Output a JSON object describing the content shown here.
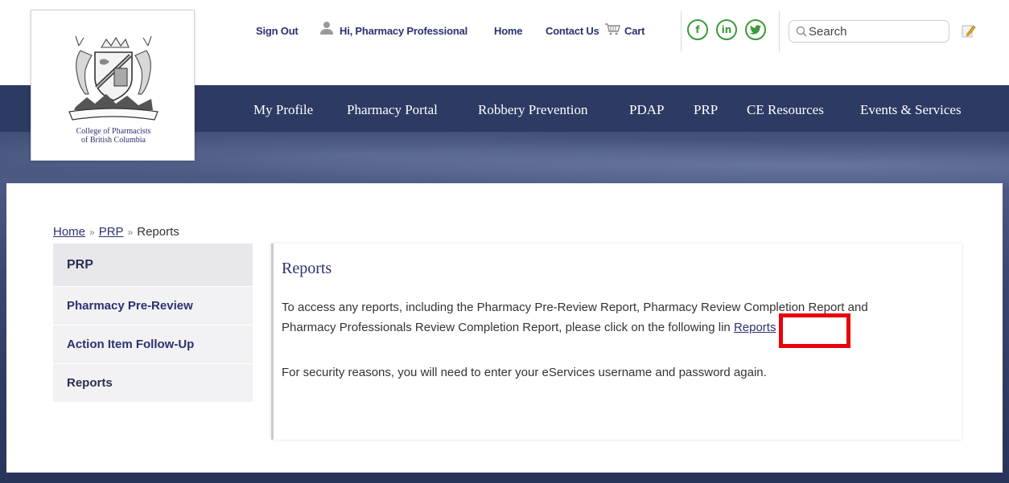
{
  "header": {
    "sign_out": "Sign Out",
    "greeting": "Hi, Pharmacy Professional",
    "home": "Home",
    "contact_us": "Contact Us",
    "cart": "Cart",
    "social": {
      "facebook": "f",
      "linkedin": "in",
      "twitter": "t"
    },
    "search_placeholder": "Search",
    "icons": [
      "user-icon",
      "cart-icon",
      "facebook-icon",
      "linkedin-icon",
      "twitter-icon",
      "search-icon",
      "edit-icon"
    ]
  },
  "logo": {
    "line1": "College of Pharmacists",
    "line2": "of British Columbia"
  },
  "nav": {
    "items": [
      "My Profile",
      "Pharmacy Portal",
      "Robbery Prevention",
      "PDAP",
      "PRP",
      "CE Resources",
      "Events & Services"
    ]
  },
  "breadcrumb": {
    "home": "Home",
    "sep": "»",
    "prp": "PRP",
    "current": "Reports"
  },
  "sidebar": {
    "heading": "PRP",
    "items": [
      "Pharmacy Pre-Review",
      "Action Item Follow-Up",
      "Reports"
    ]
  },
  "content": {
    "title": "Reports",
    "line1": "To access any reports, including the Pharmacy Pre-Review Report, Pharmacy Review Completion Report and",
    "line2_prefix": "Pharmacy Professionals Review Completion Report, please click on the following lin",
    "link_text": "Reports",
    "line3": "For security reasons, you will need to enter your eServices username and password again."
  },
  "colors": {
    "navy": "#2d3a64",
    "link": "#2b3170",
    "social_green": "#3a9a3a",
    "highlight_red": "#e8000b"
  }
}
